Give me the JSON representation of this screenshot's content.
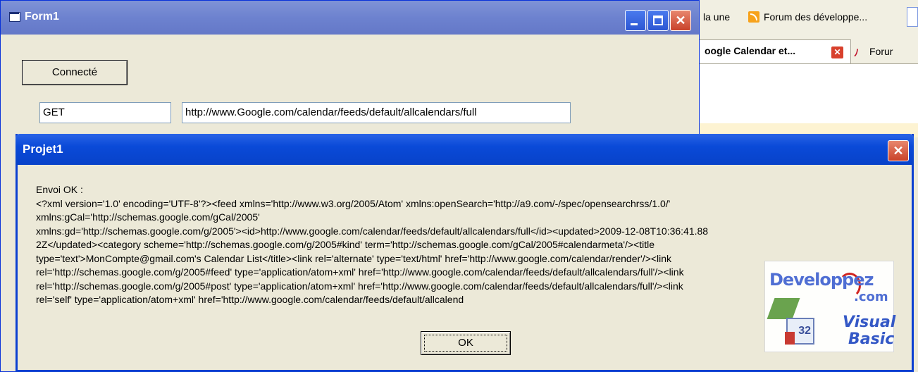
{
  "browser": {
    "bookmark_1": "la une",
    "bookmark_2": "Forum des développe...",
    "tab_active": "oogle Calendar et...",
    "tab_2": "Forur"
  },
  "form1": {
    "title": "Form1",
    "connect_label": "Connecté",
    "method_value": "GET",
    "url_value": "http://www.Google.com/calendar/feeds/default/allcalendars/full"
  },
  "dialog": {
    "title": "Projet1",
    "message_lines": [
      "Envoi OK  :",
      "<?xml version='1.0' encoding='UTF-8'?><feed xmlns='http://www.w3.org/2005/Atom' xmlns:openSearch='http://a9.com/-/spec/opensearchrss/1.0/'",
      "xmlns:gCal='http://schemas.google.com/gCal/2005'",
      "xmlns:gd='http://schemas.google.com/g/2005'><id>http://www.google.com/calendar/feeds/default/allcalendars/full</id><updated>2009-12-08T10:36:41.88",
      "2Z</updated><category scheme='http://schemas.google.com/g/2005#kind' term='http://schemas.google.com/gCal/2005#calendarmeta'/><title",
      "type='text'>MonCompte@gmail.com's Calendar List</title><link rel='alternate' type='text/html' href='http://www.google.com/calendar/render'/><link",
      "rel='http://schemas.google.com/g/2005#feed' type='application/atom+xml' href='http://www.google.com/calendar/feeds/default/allcalendars/full'/><link",
      "rel='http://schemas.google.com/g/2005#post' type='application/atom+xml' href='http://www.google.com/calendar/feeds/default/allcalendars/full'/><link",
      "rel='self' type='application/atom+xml' href='http://www.google.com/calendar/feeds/default/allcalend"
    ],
    "ok_label": "OK"
  },
  "watermark": {
    "brand": "Developpez",
    "domain": ".com",
    "badge_number": "32",
    "product_line1": "Visual",
    "product_line2": "Basic"
  },
  "icons": {
    "form_icon": "window-app-icon",
    "rss_icon": "rss-feed-icon",
    "tab_close_icon": "close-icon",
    "tab_site_icon": "site-favicon"
  }
}
